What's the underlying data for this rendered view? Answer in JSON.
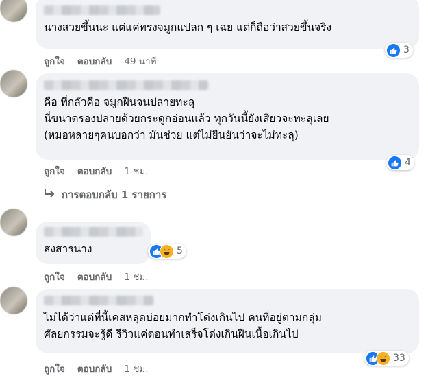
{
  "comments": [
    {
      "text": "นางสวยขึ้นนะ แต่แค่ทรงจมูกแปลก ๆ เฉย แต่ก็ถือว่าสวยขึ้นจริง",
      "like_label": "ถูกใจ",
      "reply_label": "ตอบกลับ",
      "time": "49 นาที",
      "reaction_count": "3"
    },
    {
      "text": "คือ ที่กลัวคือ จมูกฝืนจนปลายทะลุ\nนี่ขนาดรองปลายด้วยกระดูกอ่อนแล้ว ทุกวันนี้ยังเสียวจะทะลุเลย\n(หมอหลายๆคนบอกว่า มันช่วย แต่ไม่ยืนยันว่าจะไม่ทะลุ)",
      "like_label": "ถูกใจ",
      "reply_label": "ตอบกลับ",
      "time": "1 ชม.",
      "reaction_count": "4",
      "replies_label": "การตอบกลับ 1 รายการ"
    },
    {
      "text": "สงสารนาง",
      "like_label": "ถูกใจ",
      "reply_label": "ตอบกลับ",
      "time": "1 ชม.",
      "reaction_count": "5"
    },
    {
      "text": "ไม่ได้ว่าแต่ที่นี้เคสหลุดบ่อยมากทำโด่งเกินไป คนที่อยู่ตามกลุ่ม\nศัลยกรรมจะรู้ดี รีวิวแค่ตอนทำเสร็จโด่งเกินฝืนเนื้อเกินไป",
      "like_label": "ถูกใจ",
      "reply_label": "ตอบกลับ",
      "time": "1 ชม.",
      "reaction_count": "33"
    }
  ],
  "colors": {
    "like": "#1877f2",
    "haha": "#f7b125",
    "bubble": "#f0f2f5",
    "meta": "#65676b"
  }
}
